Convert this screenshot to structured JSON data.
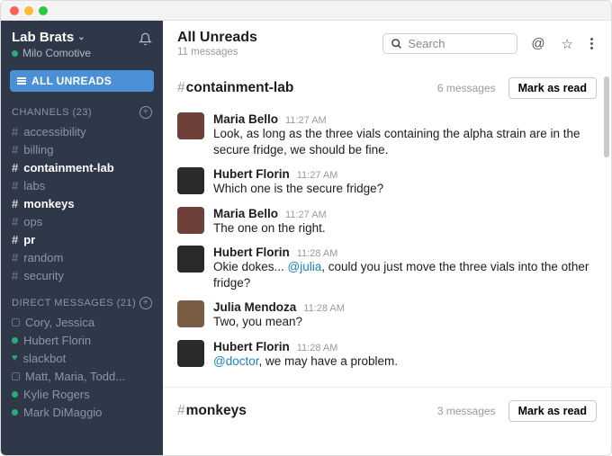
{
  "workspace": {
    "name": "Lab Brats",
    "user": "Milo Comotive"
  },
  "allUnreads": {
    "label": "ALL UNREADS",
    "title": "All Unreads",
    "subtitle": "11 messages"
  },
  "sections": {
    "channels": {
      "label": "CHANNELS",
      "count": "(23)"
    },
    "dms": {
      "label": "DIRECT MESSAGES",
      "count": "(21)"
    }
  },
  "channels": [
    {
      "name": "accessibility",
      "unread": false
    },
    {
      "name": "billing",
      "unread": false
    },
    {
      "name": "containment-lab",
      "unread": true
    },
    {
      "name": "labs",
      "unread": false
    },
    {
      "name": "monkeys",
      "unread": true
    },
    {
      "name": "ops",
      "unread": false
    },
    {
      "name": "pr",
      "unread": true
    },
    {
      "name": "random",
      "unread": false
    },
    {
      "name": "security",
      "unread": false
    }
  ],
  "dms": [
    {
      "name": "Cory, Jessica",
      "online": false,
      "icon": "multi"
    },
    {
      "name": "Hubert Florin",
      "online": true,
      "icon": "dot"
    },
    {
      "name": "slackbot",
      "online": true,
      "icon": "heart"
    },
    {
      "name": "Matt, Maria, Todd...",
      "online": false,
      "icon": "multi"
    },
    {
      "name": "Kylie Rogers",
      "online": true,
      "icon": "dot"
    },
    {
      "name": "Mark DiMaggio",
      "online": true,
      "icon": "dot"
    }
  ],
  "search": {
    "placeholder": "Search"
  },
  "blocks": [
    {
      "channel": "containment-lab",
      "count": "6 messages",
      "markRead": "Mark as read",
      "messages": [
        {
          "author": "Maria Bello",
          "time": "11:27 AM",
          "av": "av1",
          "parts": [
            {
              "t": "plain",
              "v": "Look, as long as the three vials containing the alpha strain are in the secure fridge, we should be fine."
            }
          ]
        },
        {
          "author": "Hubert Florin",
          "time": "11:27 AM",
          "av": "av2",
          "parts": [
            {
              "t": "plain",
              "v": "Which one is the secure fridge?"
            }
          ]
        },
        {
          "author": "Maria Bello",
          "time": "11:27 AM",
          "av": "av1",
          "parts": [
            {
              "t": "plain",
              "v": "The one on the right."
            }
          ]
        },
        {
          "author": "Hubert Florin",
          "time": "11:28 AM",
          "av": "av2",
          "parts": [
            {
              "t": "plain",
              "v": "Okie dokes... "
            },
            {
              "t": "mention",
              "v": "@julia"
            },
            {
              "t": "plain",
              "v": ", could you just move the three vials into the other fridge?"
            }
          ]
        },
        {
          "author": "Julia Mendoza",
          "time": "11:28 AM",
          "av": "av3",
          "parts": [
            {
              "t": "plain",
              "v": "Two, you mean?"
            }
          ]
        },
        {
          "author": "Hubert Florin",
          "time": "11:28 AM",
          "av": "av2",
          "parts": [
            {
              "t": "mention",
              "v": "@doctor"
            },
            {
              "t": "plain",
              "v": ", we may have a problem."
            }
          ]
        }
      ]
    },
    {
      "channel": "monkeys",
      "count": "3 messages",
      "markRead": "Mark as read",
      "messages": []
    }
  ]
}
